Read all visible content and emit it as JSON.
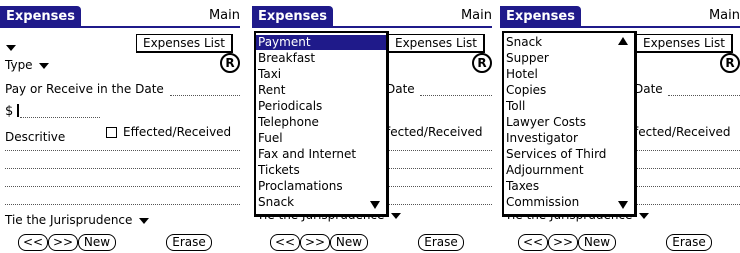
{
  "colors": {
    "title_bar": "#1f1a8a",
    "selection": "#1f1a8a"
  },
  "screens": [
    {
      "title": "Expenses",
      "menu": "Main",
      "expenses_list_button": "Expenses List",
      "type_label": "Type",
      "date_label": "Pay or Receive in the Date",
      "currency_symbol": "$",
      "descriptive_label": "Descritive",
      "effected_label": "Effected/Received",
      "jurisprudence_label": "Tie the Jurisprudence",
      "nav_prev": "<<",
      "nav_next": ">>",
      "new_button": "New",
      "erase_button": "Erase",
      "r_icon": "R"
    },
    {
      "title": "Expenses",
      "menu": "Main",
      "expenses_list_button": "Expenses List",
      "date_label_partial": "Date",
      "effected_label_partial": "fected/Received",
      "jurisprudence_label_partial": "Tie the Jurisprudence",
      "nav_prev": "<<",
      "nav_next": ">>",
      "new_button": "New",
      "erase_button": "Erase",
      "r_icon": "R",
      "popup_items": [
        "Payment",
        "Breakfast",
        "Taxi",
        "Rent",
        "Periodicals",
        "Telephone",
        "Fuel",
        "Fax and Internet",
        "Tickets",
        "Proclamations",
        "Snack"
      ],
      "popup_selected": "Payment"
    },
    {
      "title": "Expenses",
      "menu": "Main",
      "expenses_list_button": "Expenses List",
      "date_label_partial": "Date",
      "effected_label_partial": "fected/Received",
      "jurisprudence_label_partial": "Tie the Jurisprudence",
      "nav_prev": "<<",
      "nav_next": ">>",
      "new_button": "New",
      "erase_button": "Erase",
      "r_icon": "R",
      "popup_items": [
        "Snack",
        "Supper",
        "Hotel",
        "Copies",
        "Toll",
        "Lawyer Costs",
        "Investigator",
        "Services of Third",
        "Adjournment",
        "Taxes",
        "Commission"
      ]
    }
  ]
}
